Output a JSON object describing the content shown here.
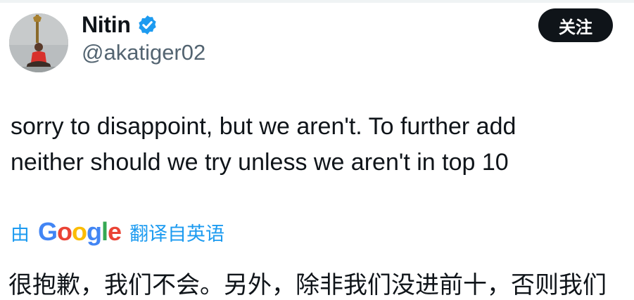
{
  "user": {
    "display_name": "Nitin",
    "handle": "@akatiger02",
    "verified": true
  },
  "follow_button": {
    "label": "关注"
  },
  "tweet": {
    "lines": [
      "sorry to disappoint, but we aren't. To further add",
      "neither should we try unless we aren't in top 10"
    ]
  },
  "translation": {
    "by_label": "由",
    "provider_logo_text": "Google",
    "action_label": "翻译自英语",
    "translated_text": "很抱歉，我们不会。另外，除非我们没进前十，否则我们"
  },
  "colors": {
    "link_blue": "#1d9bf0",
    "verified_blue": "#1d9bf0",
    "button_bg": "#0f1419",
    "secondary_text": "#536471"
  },
  "icons": {
    "verified": "verified-badge-icon"
  }
}
